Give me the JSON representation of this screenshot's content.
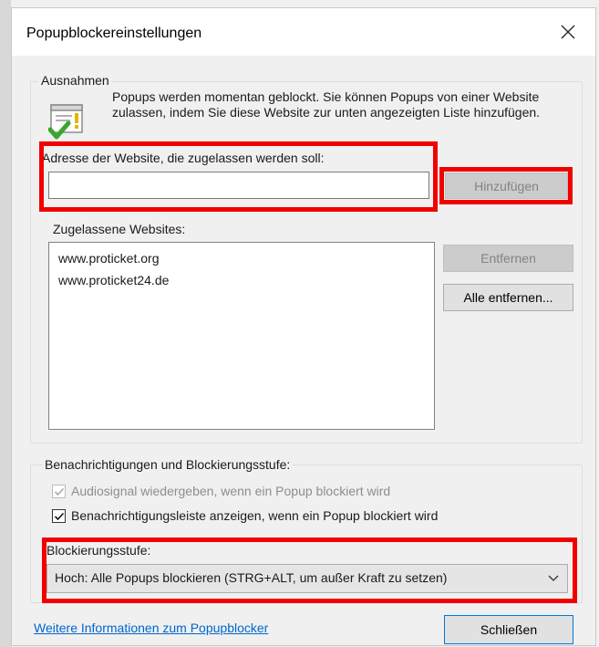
{
  "window": {
    "title": "Popupblockereinstellungen"
  },
  "exceptions": {
    "legend": "Ausnahmen",
    "info_text": "Popups werden momentan geblockt. Sie können Popups von einer Website zulassen, indem Sie diese Website zur unten angezeigten Liste hinzufügen.",
    "address_label": "Adresse der Website, die zugelassen werden soll:",
    "address_value": "",
    "add_button": "Hinzufügen",
    "allowed_label": "Zugelassene Websites:",
    "allowed_sites": [
      "www.proticket.org",
      "www.proticket24.de"
    ],
    "remove_button": "Entfernen",
    "remove_all_button": "Alle entfernen..."
  },
  "notifications": {
    "legend": "Benachrichtigungen und Blockierungsstufe:",
    "sound": {
      "label": "Audiosignal wiedergeben, wenn ein Popup blockiert wird",
      "checked": true,
      "enabled": false
    },
    "info_bar": {
      "label": "Benachrichtigungsleiste anzeigen, wenn ein Popup blockiert wird",
      "checked": true,
      "enabled": true
    },
    "level_label": "Blockierungsstufe:",
    "level_value": "Hoch: Alle Popups blockieren (STRG+ALT, um außer Kraft zu setzen)"
  },
  "footer": {
    "more_info_link": "Weitere Informationen zum Popupblocker",
    "close_button": "Schließen"
  },
  "colors": {
    "highlight": "#f20000",
    "link": "#0066cc",
    "check": "#3aa62f"
  }
}
